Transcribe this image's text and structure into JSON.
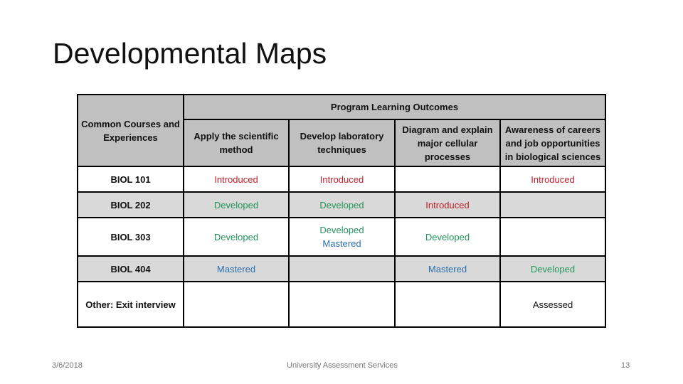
{
  "slide": {
    "title": "Developmental Maps",
    "footer": {
      "date": "3/6/2018",
      "center": "University Assessment Services",
      "page_number": "13"
    }
  },
  "legend_colors": {
    "Introduced": "#c0202a",
    "Developed": "#22955a",
    "Mastered": "#2a6fb0",
    "Assessed": "#111111"
  },
  "table": {
    "group_header": "Program Learning Outcomes",
    "first_column_header": "Common Courses and Experiences",
    "outcomes": [
      "Apply the scientific method",
      "Develop laboratory techniques",
      "Diagram and explain major cellular processes",
      "Awareness of careers and job opportunities in biological sciences"
    ],
    "rows": [
      {
        "course": "BIOL 101",
        "cells": [
          [
            {
              "text": "Introduced",
              "level": "introduced"
            }
          ],
          [
            {
              "text": "Introduced",
              "level": "introduced"
            }
          ],
          [],
          [
            {
              "text": "Introduced",
              "level": "introduced"
            }
          ]
        ]
      },
      {
        "course": "BIOL 202",
        "cells": [
          [
            {
              "text": "Developed",
              "level": "developed"
            }
          ],
          [
            {
              "text": "Developed",
              "level": "developed"
            }
          ],
          [
            {
              "text": "Introduced",
              "level": "introduced"
            }
          ],
          []
        ]
      },
      {
        "course": "BIOL 303",
        "cells": [
          [
            {
              "text": "Developed",
              "level": "developed"
            }
          ],
          [
            {
              "text": "Developed",
              "level": "developed"
            },
            {
              "text": "Mastered",
              "level": "mastered"
            }
          ],
          [
            {
              "text": "Developed",
              "level": "developed"
            }
          ],
          []
        ]
      },
      {
        "course": "BIOL 404",
        "cells": [
          [
            {
              "text": "Mastered",
              "level": "mastered"
            }
          ],
          [],
          [
            {
              "text": "Mastered",
              "level": "mastered"
            }
          ],
          [
            {
              "text": "Developed",
              "level": "developed"
            }
          ]
        ]
      },
      {
        "course": "Other: Exit interview",
        "cells": [
          [],
          [],
          [],
          [
            {
              "text": "Assessed",
              "level": "assessed"
            }
          ]
        ]
      }
    ]
  }
}
